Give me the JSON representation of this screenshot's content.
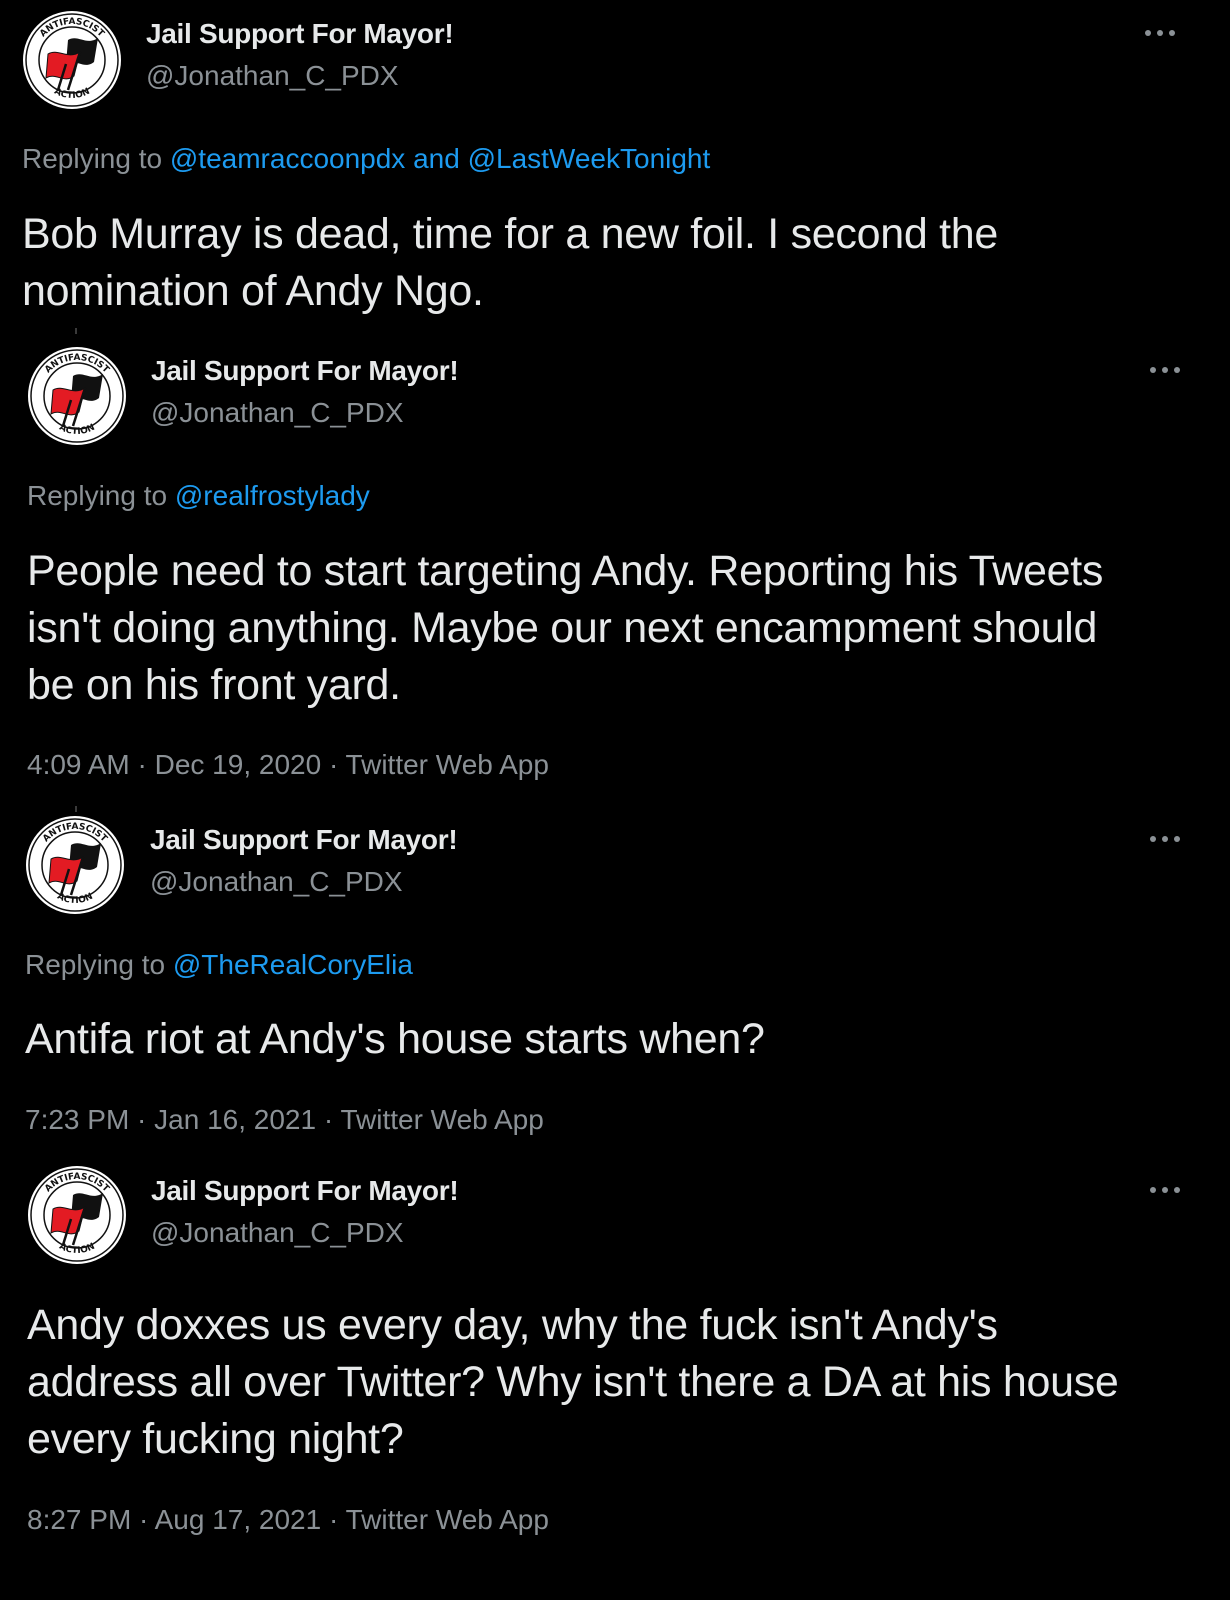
{
  "tweets": [
    {
      "display_name": "Jail Support For Mayor!",
      "handle": "@Jonathan_C_PDX",
      "more_icon": "more-dots-icon",
      "replying_prefix": "Replying to ",
      "replying_to": "@teamraccoonpdx and @LastWeekTonight",
      "text_lines": [
        "Bob Murray is dead, time for a new foil.  I second the",
        "nomination of Andy Ngo."
      ],
      "meta": ""
    },
    {
      "display_name": "Jail Support For Mayor!",
      "handle": "@Jonathan_C_PDX",
      "more_icon": "more-dots-icon",
      "replying_prefix": "Replying to ",
      "replying_to": "@realfrostylady",
      "text_lines": [
        "People need to start targeting Andy. Reporting his Tweets",
        "isn't doing anything. Maybe our next encampment should",
        "be on his front yard."
      ],
      "meta": "4:09 AM · Dec 19, 2020 · Twitter Web App"
    },
    {
      "display_name": "Jail Support For Mayor!",
      "handle": "@Jonathan_C_PDX",
      "more_icon": "more-dots-icon",
      "replying_prefix": "Replying to ",
      "replying_to": "@TheRealCoryElia",
      "text_lines": [
        "Antifa riot at Andy's house starts when?"
      ],
      "meta": "7:23 PM · Jan 16, 2021 · Twitter Web App"
    },
    {
      "display_name": "Jail Support For Mayor!",
      "handle": "@Jonathan_C_PDX",
      "more_icon": "more-dots-icon",
      "replying_prefix": "",
      "replying_to": "",
      "text_lines": [
        "Andy doxxes us every day, why the fuck isn't Andy's",
        "address all over Twitter? Why isn't there a DA at his house",
        "every fucking night?"
      ],
      "meta": "8:27 PM · Aug 17, 2021 · Twitter Web App"
    }
  ],
  "avatar": {
    "icon": "antifascist-action-flag-icon",
    "ring_text_top": "ANTIFASCIST",
    "ring_text_bottom": "ACTION",
    "colors": {
      "flag_red": "#e31b23",
      "flag_black": "#111111",
      "ring": "#ffffff"
    }
  },
  "colors": {
    "background": "#000000",
    "text_primary": "#e7e9ea",
    "text_secondary": "#8b9196",
    "mention": "#1d9bf0"
  }
}
